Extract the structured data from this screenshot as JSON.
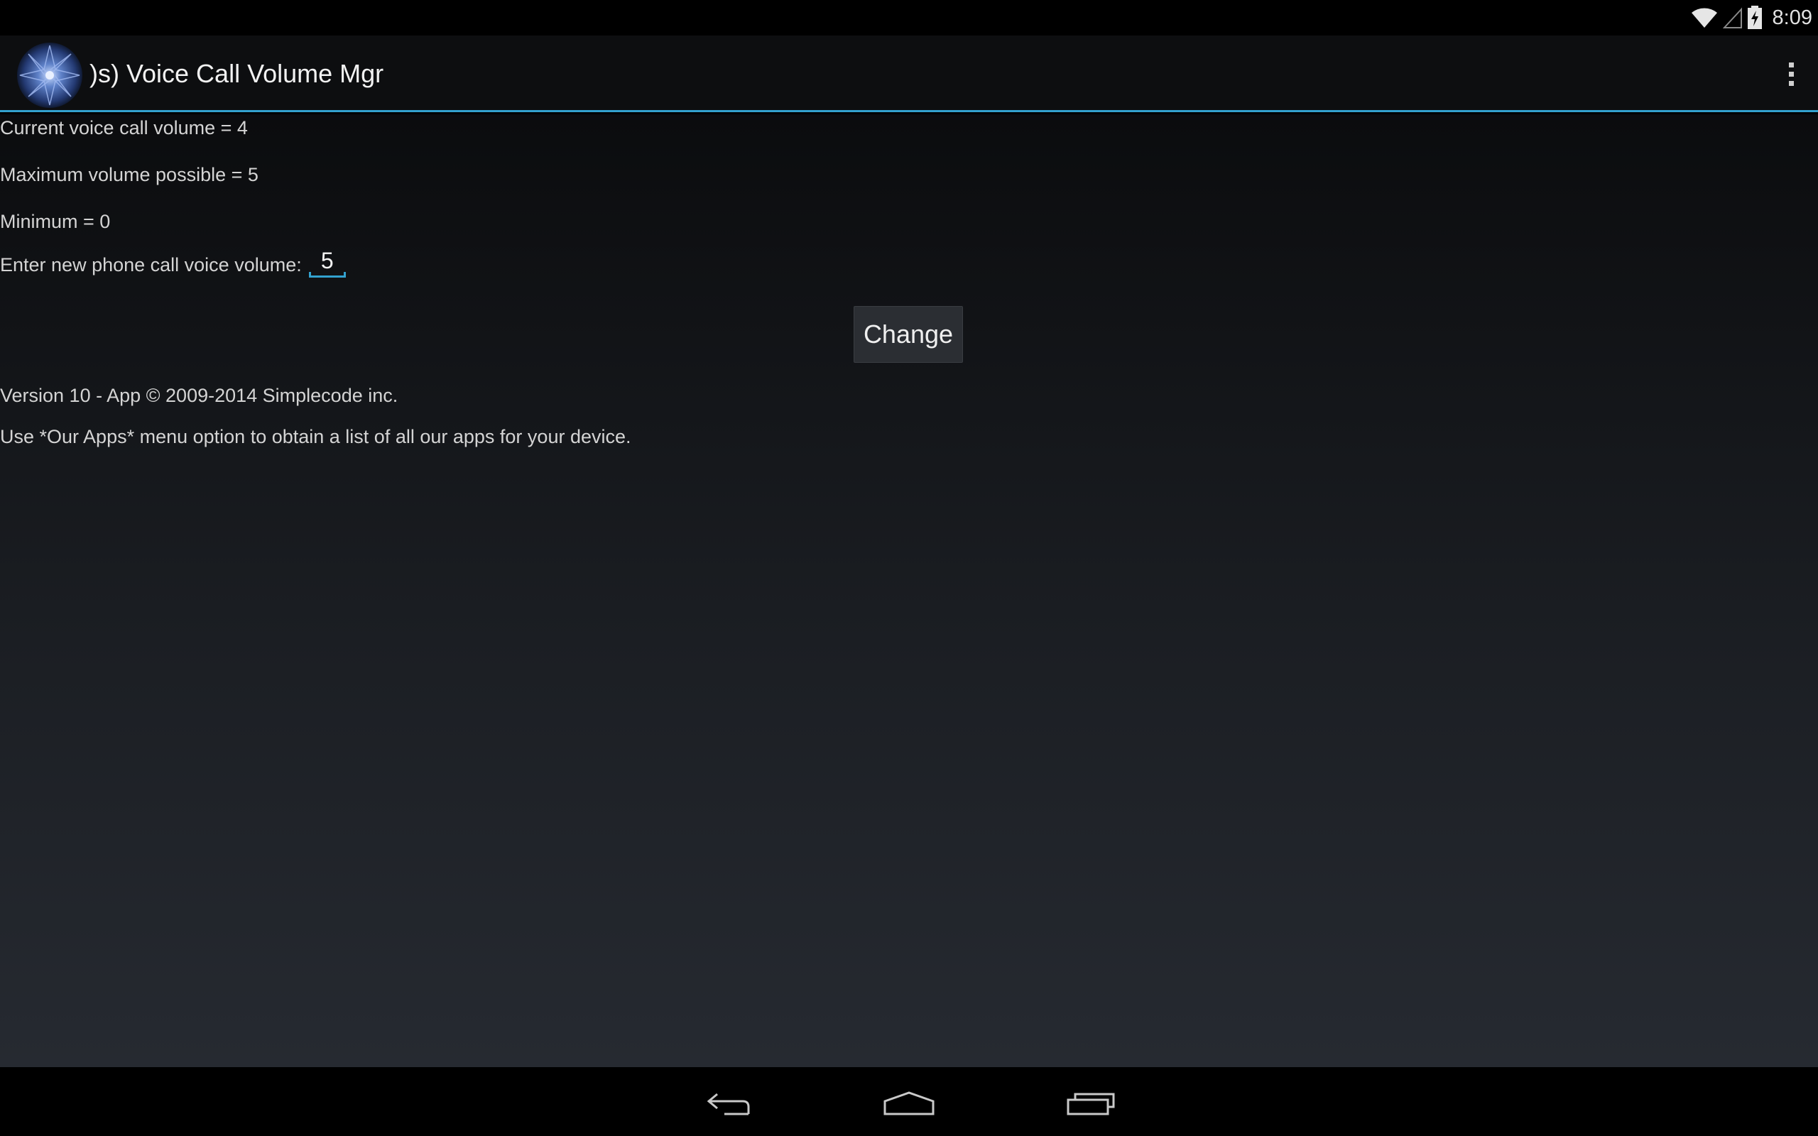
{
  "status_bar": {
    "time": "8:09",
    "icons": [
      "wifi-icon",
      "signal-icon",
      "battery-charging-icon"
    ]
  },
  "action_bar": {
    "app_icon": "app-logo-icon",
    "title": ")s) Voice Call Volume Mgr",
    "overflow_icon": "overflow-menu-icon"
  },
  "content": {
    "current_volume": "Current voice call volume = 4",
    "maximum_volume": "Maximum volume possible = 5",
    "minimum_volume": "Minimum = 0",
    "enter_label": "Enter new phone call voice volume:",
    "volume_input_value": "5",
    "change_button_label": "Change",
    "version_text": "Version 10 - App © 2009-2014 Simplecode inc.",
    "hint_text": "Use *Our Apps* menu option to obtain a list of all our apps for your device."
  },
  "nav_bar": {
    "buttons": [
      "back-icon",
      "home-icon",
      "recents-icon"
    ]
  },
  "colors": {
    "accent": "#33a2cf",
    "action_bar": "#0d0e10",
    "background_top": "#0b0c0e",
    "background_bottom": "#262a31"
  }
}
